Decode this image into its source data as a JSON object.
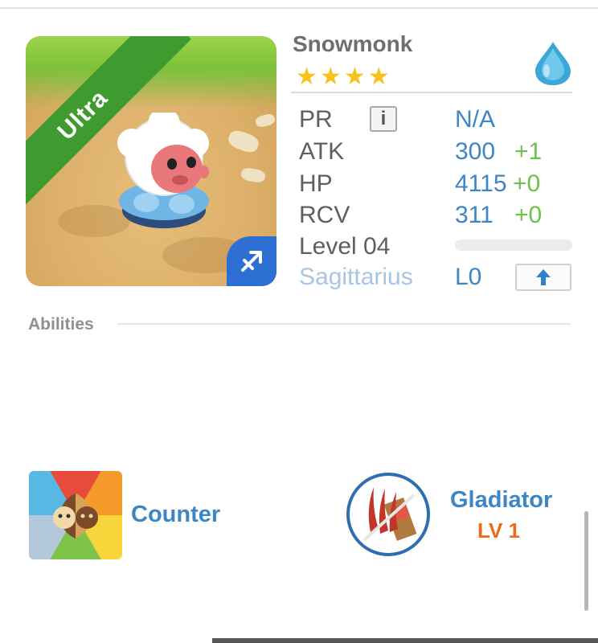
{
  "monster": {
    "name": "Snowmonk",
    "rarity": "Ultra",
    "stars": 4,
    "element_icon": "water-drop-icon",
    "zodiac_icon": "sagittarius-icon"
  },
  "stats": {
    "pr": {
      "label": "PR",
      "value": "N/A"
    },
    "atk": {
      "label": "ATK",
      "value": "300",
      "bonus": "+1"
    },
    "hp": {
      "label": "HP",
      "value": "4115",
      "bonus": "+0"
    },
    "rcv": {
      "label": "RCV",
      "value": "311",
      "bonus": "+0"
    },
    "level": {
      "label": "Level 04",
      "progress": 0
    },
    "zodiac": {
      "label": "Sagittarius",
      "value": "L0"
    }
  },
  "abilities": {
    "heading": "Abilities",
    "items": [
      {
        "name": "Counter",
        "icon": "counter-icon"
      },
      {
        "name": "Gladiator",
        "level": "LV 1",
        "icon": "gladiator-icon"
      }
    ]
  },
  "colors": {
    "accent_blue": "#3d86c6",
    "bonus_green": "#6cc24a",
    "level_orange": "#ee6a1a",
    "rarity_green": "#3f9a2f"
  }
}
